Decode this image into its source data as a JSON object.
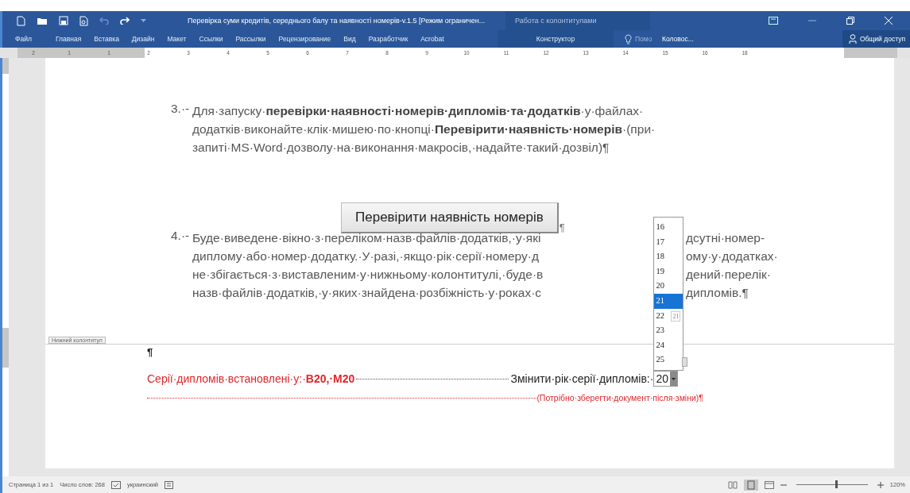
{
  "window": {
    "title": "Перевірка суми кредитів, середнього балу та наявності номерів-v.1.5 [Режим ограничен...",
    "context_title": "Работа с колонтитулами"
  },
  "ribbon_tabs": [
    {
      "label": "Файл",
      "selected": false
    },
    {
      "label": "Главная",
      "selected": false
    },
    {
      "label": "Вставка",
      "selected": false
    },
    {
      "label": "Дизайн",
      "selected": false
    },
    {
      "label": "Макет",
      "selected": false
    },
    {
      "label": "Ссылки",
      "selected": false
    },
    {
      "label": "Рассылки",
      "selected": false
    },
    {
      "label": "Рецензирование",
      "selected": false
    },
    {
      "label": "Вид",
      "selected": false
    },
    {
      "label": "Разработчик",
      "selected": false
    },
    {
      "label": "Acrobat",
      "selected": false
    }
  ],
  "context_tab": {
    "label": "Конструктор",
    "selected": false
  },
  "tell_me": {
    "placeholder": "Помо"
  },
  "user": "Коловос...",
  "share": "Общий доступ",
  "ruler": [
    "2",
    "1",
    "1",
    "2",
    "3",
    "4",
    "5",
    "6",
    "7",
    "8",
    "9",
    "10",
    "11",
    "12",
    "13",
    "14",
    "15",
    "16",
    "18"
  ],
  "document": {
    "step3": {
      "number": "3.·-",
      "lines": [
        "Для·запуску·**перевірки·наявності·номерів·дипломів·та·додатків**·у·файлах·",
        "додатків·виконайте·клік·мишею·по·кнопці·**Перевірити·наявність·номерів**·(при·",
        "запиті·MS·Word·дозволу·на·виконання·макросів,·надайте·такий·дозвіл)¶"
      ]
    },
    "check_button": "Перевірити наявність номерів",
    "button_mark": "¶",
    "step4": {
      "number": "4.·-",
      "lines": [
        {
          "left": "Буде·виведене·вікно·з·переліком·назв·файлів·додатків,·у·які",
          "right": "дсутні·номер-"
        },
        {
          "left": "диплому·або·номер·додатку.·У·разі,·якщо·рік·серії·номеру·д",
          "right": "ому·у·додатках·"
        },
        {
          "left": "не·збігається·з·виставленим·у·нижньому·колонтитулі,·буде·в",
          "right": "дений·перелік·"
        },
        {
          "left": "назв·файлів·додатків,·у·яких·знайдена·розбіжність·у·роках·с",
          "right": "дипломів.¶"
        }
      ]
    },
    "footer": {
      "label": "Нижний колонтитул",
      "pilcrow": "¶",
      "series": "Серії·дипломів·встановлені·у:·**B20,·M20**",
      "change_label": "Змінити·рік·серії·дипломів:·",
      "year_value": "20",
      "note": "(Потрібно·зберегти·документ·після·зміни)¶"
    },
    "year_dropdown": {
      "options": [
        {
          "label": "16",
          "selected": false
        },
        {
          "label": "17",
          "selected": false
        },
        {
          "label": "18",
          "selected": false
        },
        {
          "label": "19",
          "selected": false
        },
        {
          "label": "20",
          "selected": false
        },
        {
          "label": "21",
          "selected": true
        },
        {
          "label": "22",
          "selected": false
        },
        {
          "label": "23",
          "selected": false
        },
        {
          "label": "24",
          "selected": false
        },
        {
          "label": "25",
          "selected": false
        }
      ],
      "tooltip": "21"
    }
  },
  "status_bar": {
    "page": "Страница 1 из 1",
    "words": "Число слов: 268",
    "language": "украинский",
    "zoom": "120%",
    "zoom_slider": {
      "level": 0.55
    }
  }
}
